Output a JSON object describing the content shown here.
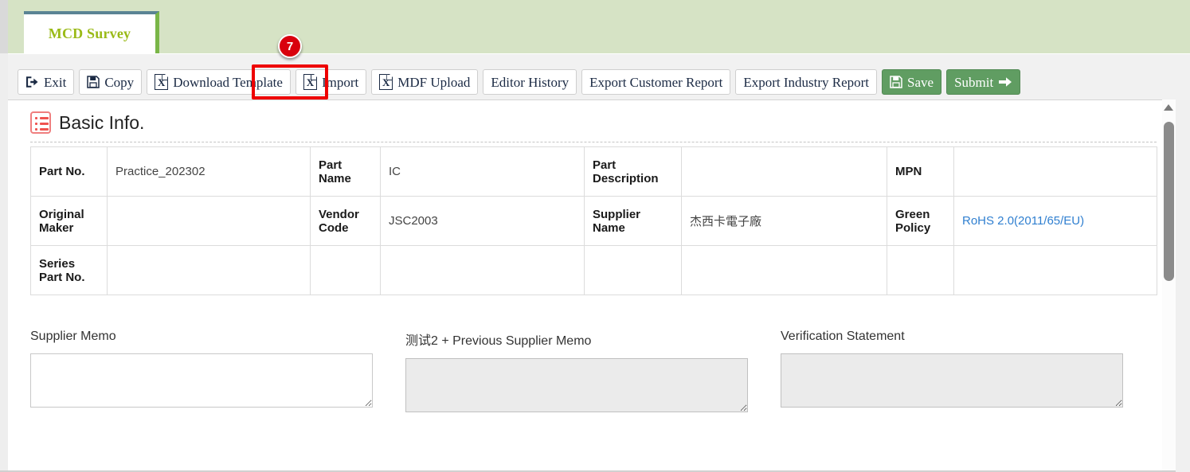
{
  "tab": {
    "label": "MCD Survey"
  },
  "step_badge": {
    "number": "7"
  },
  "toolbar": {
    "buttons": [
      {
        "label": "Exit",
        "icon": "sign-out-icon",
        "style": "default"
      },
      {
        "label": "Copy",
        "icon": "save-icon",
        "style": "default"
      },
      {
        "label": "Download Template",
        "icon": "excel-icon",
        "style": "default"
      },
      {
        "label": "Import",
        "icon": "excel-icon",
        "style": "default"
      },
      {
        "label": "MDF Upload",
        "icon": "excel-icon",
        "style": "default"
      },
      {
        "label": "Editor History",
        "icon": "",
        "style": "default"
      },
      {
        "label": "Export Customer Report",
        "icon": "",
        "style": "default"
      },
      {
        "label": "Export Industry Report",
        "icon": "",
        "style": "default"
      },
      {
        "label": "Save",
        "icon": "save-icon",
        "style": "green"
      },
      {
        "label": "Submit",
        "icon": "arrow-right-icon",
        "style": "green"
      }
    ]
  },
  "section": {
    "title": "Basic Info.",
    "icon": "list-icon"
  },
  "basic_info": {
    "rows": [
      [
        {
          "type": "label",
          "text": "Part No."
        },
        {
          "type": "value",
          "text": "Practice_202302"
        },
        {
          "type": "label",
          "text": "Part Name"
        },
        {
          "type": "value",
          "text": "IC"
        },
        {
          "type": "label",
          "text": "Part Description"
        },
        {
          "type": "value",
          "text": ""
        },
        {
          "type": "label",
          "text": "MPN"
        },
        {
          "type": "value",
          "text": ""
        }
      ],
      [
        {
          "type": "label",
          "text": "Original Maker"
        },
        {
          "type": "value",
          "text": ""
        },
        {
          "type": "label",
          "text": "Vendor Code"
        },
        {
          "type": "value",
          "text": "JSC2003"
        },
        {
          "type": "label",
          "text": "Supplier Name"
        },
        {
          "type": "value",
          "text": "杰西卡電子廠"
        },
        {
          "type": "label",
          "text": "Green Policy"
        },
        {
          "type": "link",
          "text": "RoHS 2.0(2011/65/EU)"
        }
      ],
      [
        {
          "type": "label",
          "text": "Series Part No."
        },
        {
          "type": "value",
          "text": ""
        },
        {
          "type": "label",
          "text": ""
        },
        {
          "type": "value",
          "text": ""
        },
        {
          "type": "label",
          "text": ""
        },
        {
          "type": "value",
          "text": ""
        },
        {
          "type": "label",
          "text": ""
        },
        {
          "type": "value",
          "text": ""
        }
      ]
    ]
  },
  "memos": [
    {
      "label": "Supplier Memo",
      "value": "",
      "disabled": false
    },
    {
      "label": "测试2 + Previous Supplier Memo",
      "value": "",
      "disabled": true
    },
    {
      "label": "Verification Statement",
      "value": "",
      "disabled": true
    }
  ],
  "colors": {
    "header_band": "#d6e3c5",
    "tab_accent_top": "#5a8494",
    "tab_accent_right": "#7ab648",
    "tab_text": "#9aba17",
    "toolbar_bg": "#f1f1f1",
    "green_button": "#609d62",
    "highlight_ring": "#ee0000",
    "badge": "#d9000d",
    "link": "#2f7fd0",
    "section_icon": "#ef5350"
  }
}
